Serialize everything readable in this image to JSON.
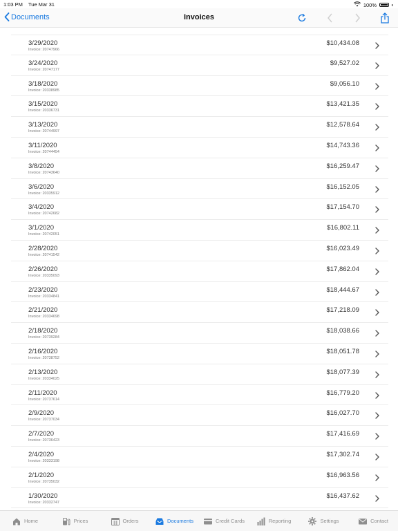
{
  "status_bar": {
    "time": "1:03 PM",
    "date": "Tue Mar 31",
    "battery": "100%"
  },
  "nav": {
    "back_label": "Documents",
    "title": "Invoices"
  },
  "invoices": [
    {
      "date": "3/29/2020",
      "invoice": "Invoice: 20747966",
      "amount": "$10,434.08"
    },
    {
      "date": "3/24/2020",
      "invoice": "Invoice: 20747177",
      "amount": "$9,527.02"
    },
    {
      "date": "3/18/2020",
      "invoice": "Invoice: 20338985",
      "amount": "$9,056.10"
    },
    {
      "date": "3/15/2020",
      "invoice": "Invoice: 20336731",
      "amount": "$13,421.35"
    },
    {
      "date": "3/13/2020",
      "invoice": "Invoice: 20744997",
      "amount": "$12,578.64"
    },
    {
      "date": "3/11/2020",
      "invoice": "Invoice: 20744454",
      "amount": "$14,743.36"
    },
    {
      "date": "3/8/2020",
      "invoice": "Invoice: 20743640",
      "amount": "$16,259.47"
    },
    {
      "date": "3/6/2020",
      "invoice": "Invoice: 20335912",
      "amount": "$16,152.05"
    },
    {
      "date": "3/4/2020",
      "invoice": "Invoice: 20742682",
      "amount": "$17,154.70"
    },
    {
      "date": "3/1/2020",
      "invoice": "Invoice: 20742051",
      "amount": "$16,802.11"
    },
    {
      "date": "2/28/2020",
      "invoice": "Invoice: 20741542",
      "amount": "$16,023.49"
    },
    {
      "date": "2/26/2020",
      "invoice": "Invoice: 20335093",
      "amount": "$17,862.04"
    },
    {
      "date": "2/23/2020",
      "invoice": "Invoice: 20334841",
      "amount": "$18,444.67"
    },
    {
      "date": "2/21/2020",
      "invoice": "Invoice: 20334698",
      "amount": "$17,218.09"
    },
    {
      "date": "2/18/2020",
      "invoice": "Invoice: 20739284",
      "amount": "$18,038.66"
    },
    {
      "date": "2/16/2020",
      "invoice": "Invoice: 20738752",
      "amount": "$18,051.78"
    },
    {
      "date": "2/13/2020",
      "invoice": "Invoice: 20334025",
      "amount": "$18,077.39"
    },
    {
      "date": "2/11/2020",
      "invoice": "Invoice: 20737614",
      "amount": "$16,779.20"
    },
    {
      "date": "2/9/2020",
      "invoice": "Invoice: 20737034",
      "amount": "$16,027.70"
    },
    {
      "date": "2/7/2020",
      "invoice": "Invoice: 20736423",
      "amount": "$17,416.69"
    },
    {
      "date": "2/4/2020",
      "invoice": "Invoice: 20333198",
      "amount": "$17,302.74"
    },
    {
      "date": "2/1/2020",
      "invoice": "Invoice: 20735032",
      "amount": "$16,963.56"
    },
    {
      "date": "1/30/2020",
      "invoice": "Invoice: 20332747",
      "amount": "$16,437.62"
    }
  ],
  "tabs": [
    {
      "label": "Home",
      "icon": "house-icon"
    },
    {
      "label": "Prices",
      "icon": "fuel-pump-icon"
    },
    {
      "label": "Orders",
      "icon": "calendar-icon"
    },
    {
      "label": "Documents",
      "icon": "inbox-tray-icon",
      "active": true
    },
    {
      "label": "Credit Cards",
      "icon": "credit-card-icon"
    },
    {
      "label": "Reporting",
      "icon": "bar-chart-icon"
    },
    {
      "label": "Settings",
      "icon": "gear-icon"
    },
    {
      "label": "Contact",
      "icon": "envelope-icon"
    }
  ],
  "colors": {
    "accent": "#1a7ae0",
    "inactive": "#8e8e8e"
  }
}
